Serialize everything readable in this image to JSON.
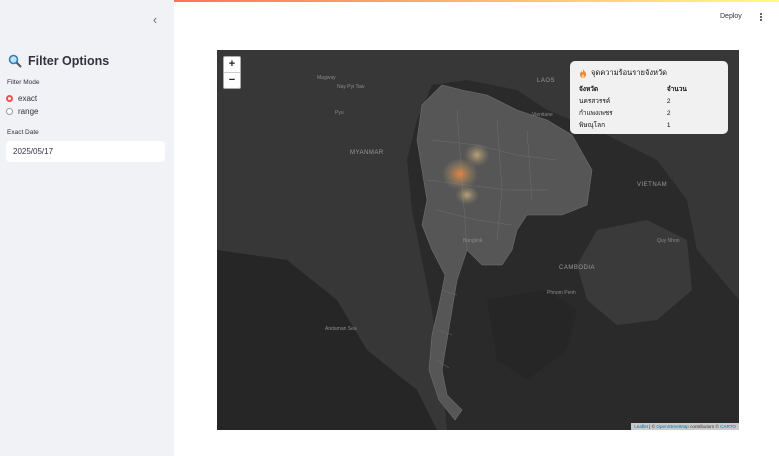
{
  "sidebar": {
    "collapse_icon": "chevron-left-icon",
    "title": "Filter Options",
    "title_icon": "magnifier-icon",
    "filter_mode_label": "Filter Mode",
    "modes": [
      {
        "label": "exact",
        "selected": true
      },
      {
        "label": "range",
        "selected": false
      }
    ],
    "exact_date_label": "Exact Date",
    "exact_date_value": "2025/05/17"
  },
  "header": {
    "deploy_label": "Deploy",
    "menu_icon": "kebab-menu-icon"
  },
  "map": {
    "zoom_in": "+",
    "zoom_out": "−",
    "legend": {
      "icon": "fire-icon",
      "title": "จุดความร้อนรายจังหวัด",
      "headers": [
        "จังหวัด",
        "จำนวน"
      ],
      "rows": [
        [
          "นครสวรรค์",
          "2"
        ],
        [
          "กำแพงเพชร",
          "2"
        ],
        [
          "พิษณุโลก",
          "1"
        ]
      ]
    },
    "attribution": {
      "leaflet": "Leaflet",
      "sep1": " | © ",
      "osm": "OpenStreetMap",
      "sep2": " contributors © ",
      "carto": "CARTO"
    },
    "labels": {
      "myanmar": "MYANMAR",
      "laos": "LAOS",
      "vietnam": "VIETNAM",
      "cambodia": "CAMBODIA",
      "andaman": "Andaman Sea",
      "myitkyina": "Magway",
      "naypyitaw": "Nay Pyi Taw",
      "pyinmana": "Pyu",
      "vientiane": "Vientiane",
      "bangkok": "Bangkok",
      "phnompenh": "Phnom Penh",
      "quynhon": "Quy Nhon"
    },
    "accent_colors": {
      "hotspot": "#e8833a",
      "radio": "#ff4b4b"
    }
  }
}
